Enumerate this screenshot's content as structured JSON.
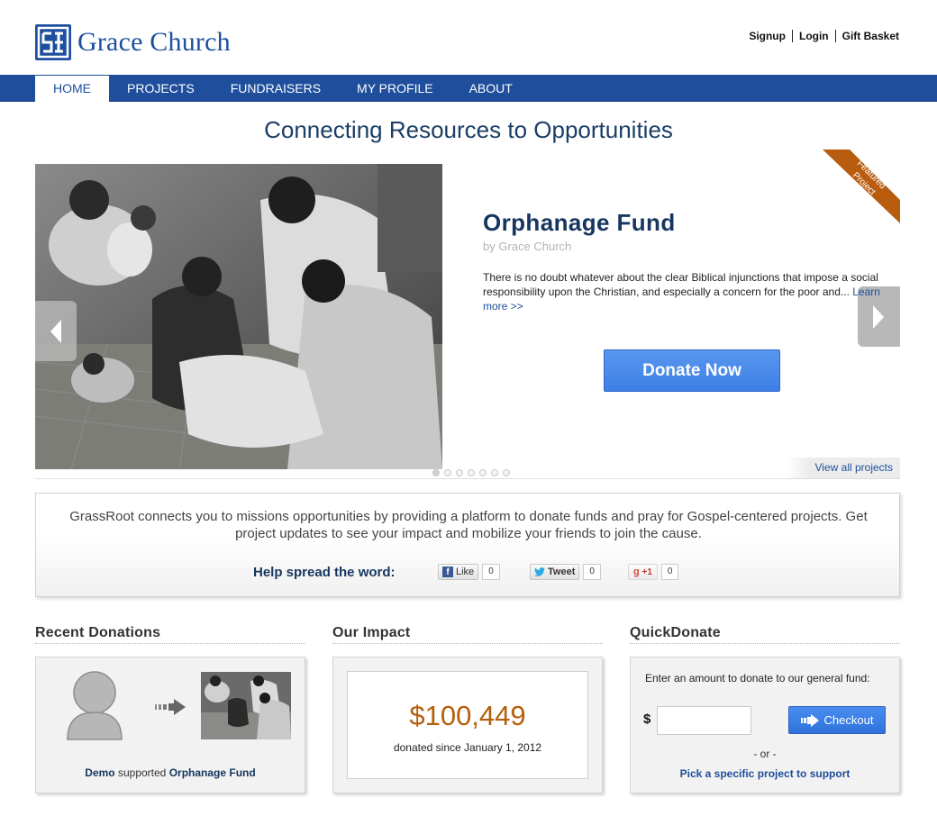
{
  "header": {
    "logo_text": "Grace Church",
    "links": [
      "Signup",
      "Login",
      "Gift Basket"
    ]
  },
  "nav": {
    "items": [
      "HOME",
      "PROJECTS",
      "FUNDRAISERS",
      "MY PROFILE",
      "ABOUT"
    ],
    "active": "HOME"
  },
  "tagline": "Connecting Resources to Opportunities",
  "featured": {
    "ribbon_line1": "Featured",
    "ribbon_line2": "Project",
    "title": "Orphanage Fund",
    "by": "by Grace Church",
    "description": "There is no doubt whatever about the clear Biblical injunctions that impose a social responsibility upon the Christian, and especially a concern for the poor and...",
    "learn_more": "Learn more >>",
    "donate_label": "Donate Now",
    "view_all": "View all projects",
    "slide_count": 7,
    "active_slide": 1
  },
  "about": {
    "text": "GrassRoot connects you to missions opportunities by providing a platform to donate funds and pray for Gospel-centered projects. Get project updates to see your impact and mobilize your friends to join the cause.",
    "spread_label": "Help spread the word:",
    "facebook": {
      "label": "Like",
      "count": "0"
    },
    "twitter": {
      "label": "Tweet",
      "count": "0"
    },
    "google": {
      "label": "+1",
      "count": "0"
    }
  },
  "recent_donations": {
    "title": "Recent Donations",
    "donor": "Demo",
    "verb": "supported",
    "project": "Orphanage Fund"
  },
  "impact": {
    "title": "Our Impact",
    "amount": "$100,449",
    "subtitle": "donated since January 1, 2012"
  },
  "quick_donate": {
    "title": "QuickDonate",
    "prompt": "Enter an amount to donate to our general fund:",
    "currency": "$",
    "amount_value": "",
    "checkout_label": "Checkout",
    "or_text": "- or -",
    "pick_link": "Pick a specific project to support"
  },
  "colors": {
    "brand_blue": "#1e4e9c",
    "accent_orange": "#b45f0b",
    "donate_blue": "#4a8ae9"
  }
}
